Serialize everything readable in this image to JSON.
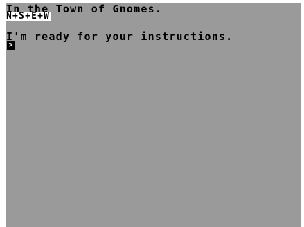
{
  "game": {
    "location_text": "In the Town of Gnomes.",
    "exits_text": "N+S+E+W",
    "message_text": "I'm ready for your instructions.",
    "prompt_symbol": ">"
  },
  "colors": {
    "screen_background": "#9a9a9a",
    "border": "#ffffff",
    "text": "#000000",
    "exits_highlight": "#ffffff"
  }
}
